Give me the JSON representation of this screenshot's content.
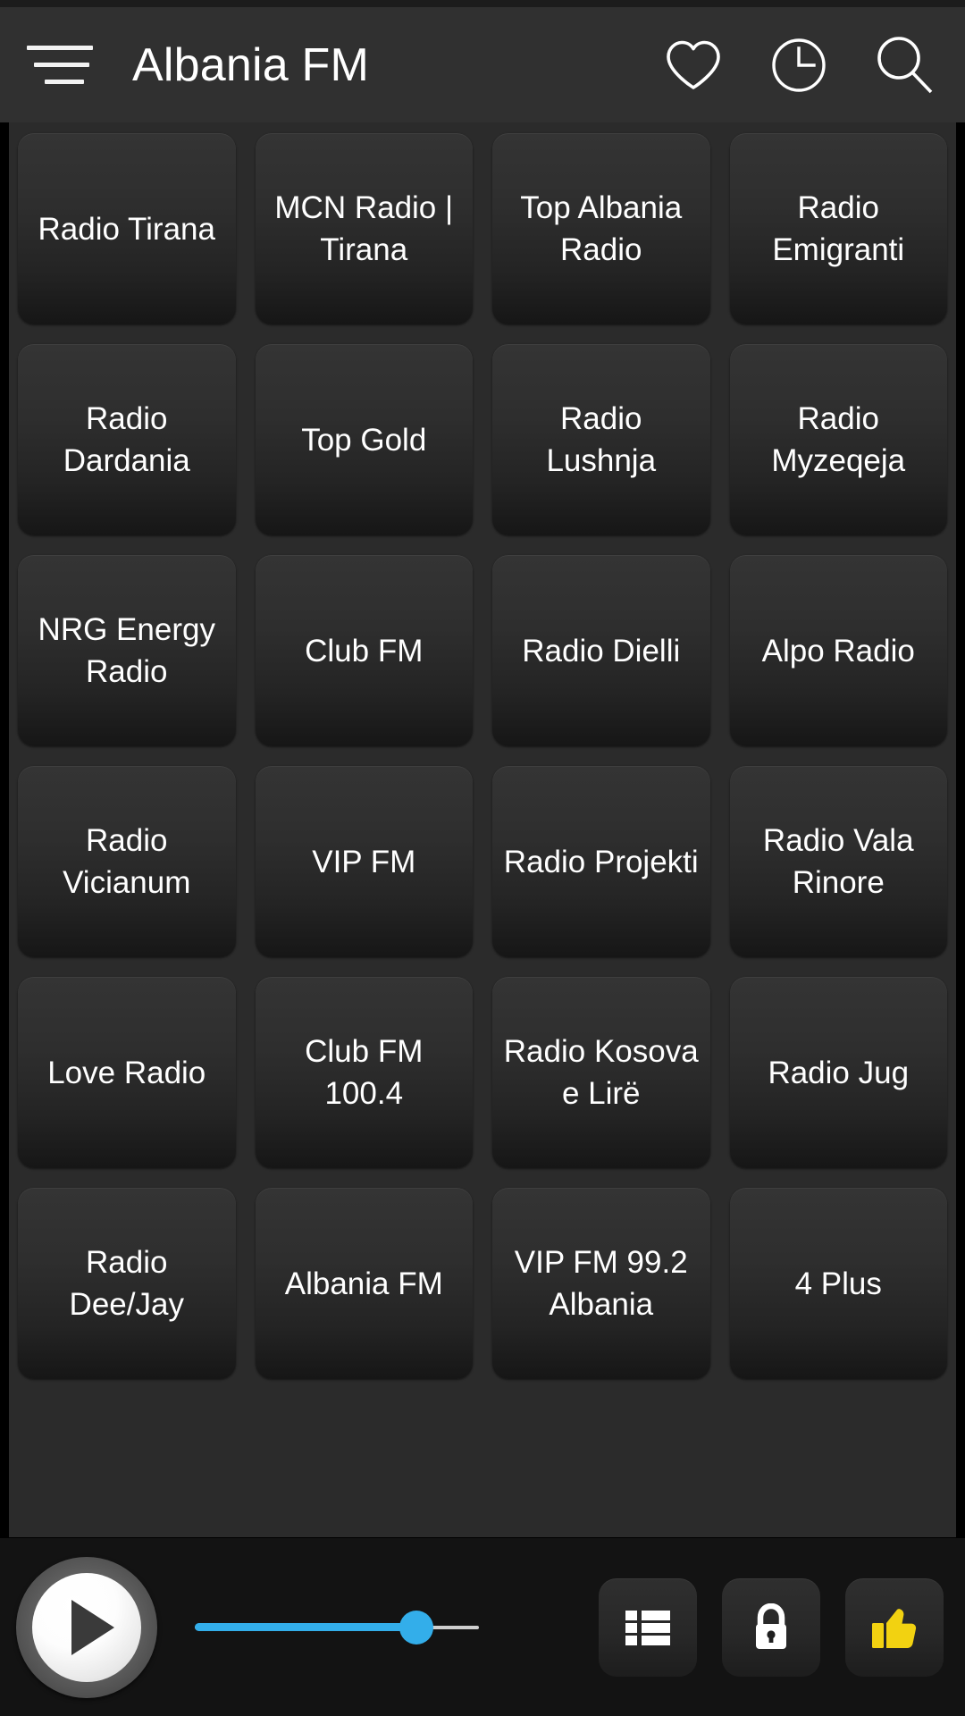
{
  "header": {
    "title": "Albania FM",
    "menu_icon": "hamburger-menu-icon",
    "actions": [
      {
        "name": "favorites-button",
        "icon": "heart-icon"
      },
      {
        "name": "history-button",
        "icon": "clock-icon"
      },
      {
        "name": "search-button",
        "icon": "search-icon"
      }
    ]
  },
  "stations": [
    {
      "label": "Radio Tirana"
    },
    {
      "label": "MCN Radio | Tirana"
    },
    {
      "label": "Top Albania Radio"
    },
    {
      "label": "Radio Emigranti"
    },
    {
      "label": "Radio Dardania"
    },
    {
      "label": "Top Gold"
    },
    {
      "label": "Radio Lushnja"
    },
    {
      "label": "Radio Myzeqeja"
    },
    {
      "label": "NRG Energy Radio"
    },
    {
      "label": "Club FM"
    },
    {
      "label": "Radio Dielli"
    },
    {
      "label": "Alpo Radio"
    },
    {
      "label": "Radio Vicianum"
    },
    {
      "label": "VIP FM"
    },
    {
      "label": "Radio Projekti"
    },
    {
      "label": "Radio Vala Rinore"
    },
    {
      "label": "Love Radio"
    },
    {
      "label": "Club FM 100.4"
    },
    {
      "label": "Radio Kosova e Lirë"
    },
    {
      "label": "Radio Jug"
    },
    {
      "label": "Radio Dee/Jay"
    },
    {
      "label": "Albania FM"
    },
    {
      "label": "VIP FM 99.2 Albania"
    },
    {
      "label": "4 Plus"
    }
  ],
  "player": {
    "play_icon": "play-icon",
    "volume": {
      "value": 78,
      "fill_color": "#33aeea",
      "track_color": "#cfcfcf"
    },
    "buttons": [
      {
        "name": "playlist-button",
        "icon": "list-icon",
        "color": "#ffffff"
      },
      {
        "name": "lock-button",
        "icon": "lock-icon",
        "color": "#ffffff"
      },
      {
        "name": "like-button",
        "icon": "thumbs-up-icon",
        "color": "#f2d211"
      }
    ]
  },
  "colors": {
    "appbar_bg": "#303030",
    "grid_bg": "#2b2b2b",
    "player_bg": "#131313",
    "accent": "#33aeea",
    "like_yellow": "#f2d211"
  }
}
